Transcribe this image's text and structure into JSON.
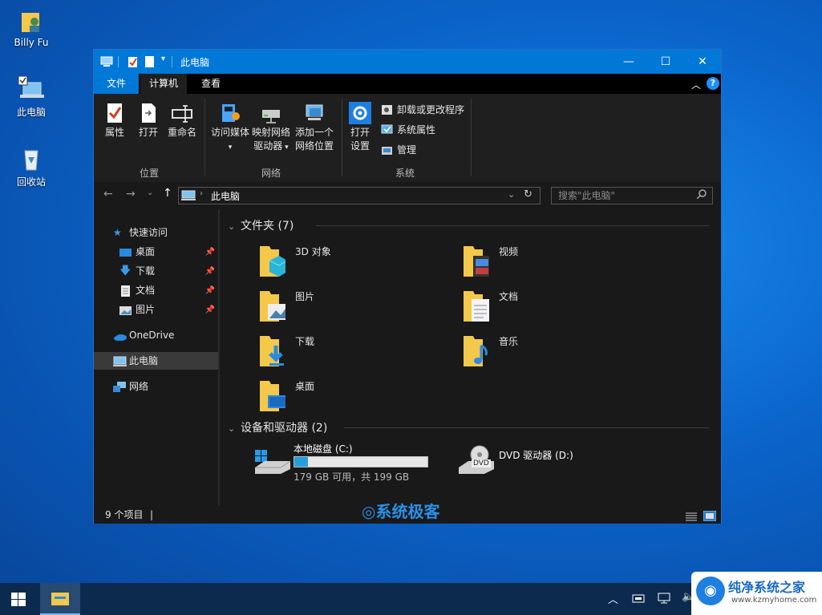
{
  "desktop": {
    "icons": [
      {
        "label": "Billy Fu",
        "icon": "user-folder-icon"
      },
      {
        "label": "此电脑",
        "icon": "this-pc-icon"
      },
      {
        "label": "回收站",
        "icon": "recycle-bin-icon"
      }
    ]
  },
  "window": {
    "title": "此电脑",
    "controls": {
      "minimize": "—",
      "maximize": "☐",
      "close": "✕"
    },
    "help": "?"
  },
  "ribbon": {
    "tabs": [
      {
        "label": "文件",
        "active": false,
        "highlight": true
      },
      {
        "label": "计算机",
        "active": true
      },
      {
        "label": "查看",
        "active": false
      }
    ],
    "groups": [
      {
        "label": "位置",
        "buttons": [
          "属性",
          "打开",
          "重命名"
        ]
      },
      {
        "label": "网络",
        "buttons": [
          "访问媒体",
          "映射网络\n驱动器",
          "添加一个\n网络位置"
        ]
      },
      {
        "label": "系统",
        "buttons": [
          "打开\n设置"
        ],
        "small_items": [
          "卸载或更改程序",
          "系统属性",
          "管理"
        ]
      }
    ],
    "labels": {
      "properties": "属性",
      "open": "打开",
      "rename": "重命名",
      "media": "访问媒体",
      "map_drive_1": "映射网络",
      "map_drive_2": "驱动器",
      "add_loc_1": "添加一个",
      "add_loc_2": "网络位置",
      "settings_1": "打开",
      "settings_2": "设置",
      "uninstall": "卸载或更改程序",
      "sysprops": "系统属性",
      "manage": "管理",
      "group_location": "位置",
      "group_network": "网络",
      "group_system": "系统"
    }
  },
  "address": {
    "path": "此电脑",
    "search_placeholder": "搜索\"此电脑\""
  },
  "nav": {
    "quick_access": "快速访问",
    "items": [
      "桌面",
      "下载",
      "文档",
      "图片"
    ],
    "onedrive": "OneDrive",
    "this_pc": "此电脑",
    "network": "网络"
  },
  "content": {
    "folders_header": "文件夹 (7)",
    "folders": [
      "3D 对象",
      "视频",
      "图片",
      "文档",
      "下载",
      "音乐",
      "桌面"
    ],
    "drives_header": "设备和驱动器 (2)",
    "drive_c": {
      "name": "本地磁盘 (C:)",
      "info": "179 GB 可用，共 199 GB",
      "used_fraction": 0.1
    },
    "drive_d": {
      "name": "DVD 驱动器 (D:)",
      "disc_label": "DVD"
    }
  },
  "status": {
    "count": "9 个项目",
    "cursor": "|"
  },
  "watermark": "系统极客",
  "corner_logo": {
    "title": "纯净系统之家",
    "url": "www.kzmyhome.com"
  },
  "colors": {
    "accent": "#0078d7",
    "dark_bg": "#191919",
    "folder": "#f3c84b"
  }
}
